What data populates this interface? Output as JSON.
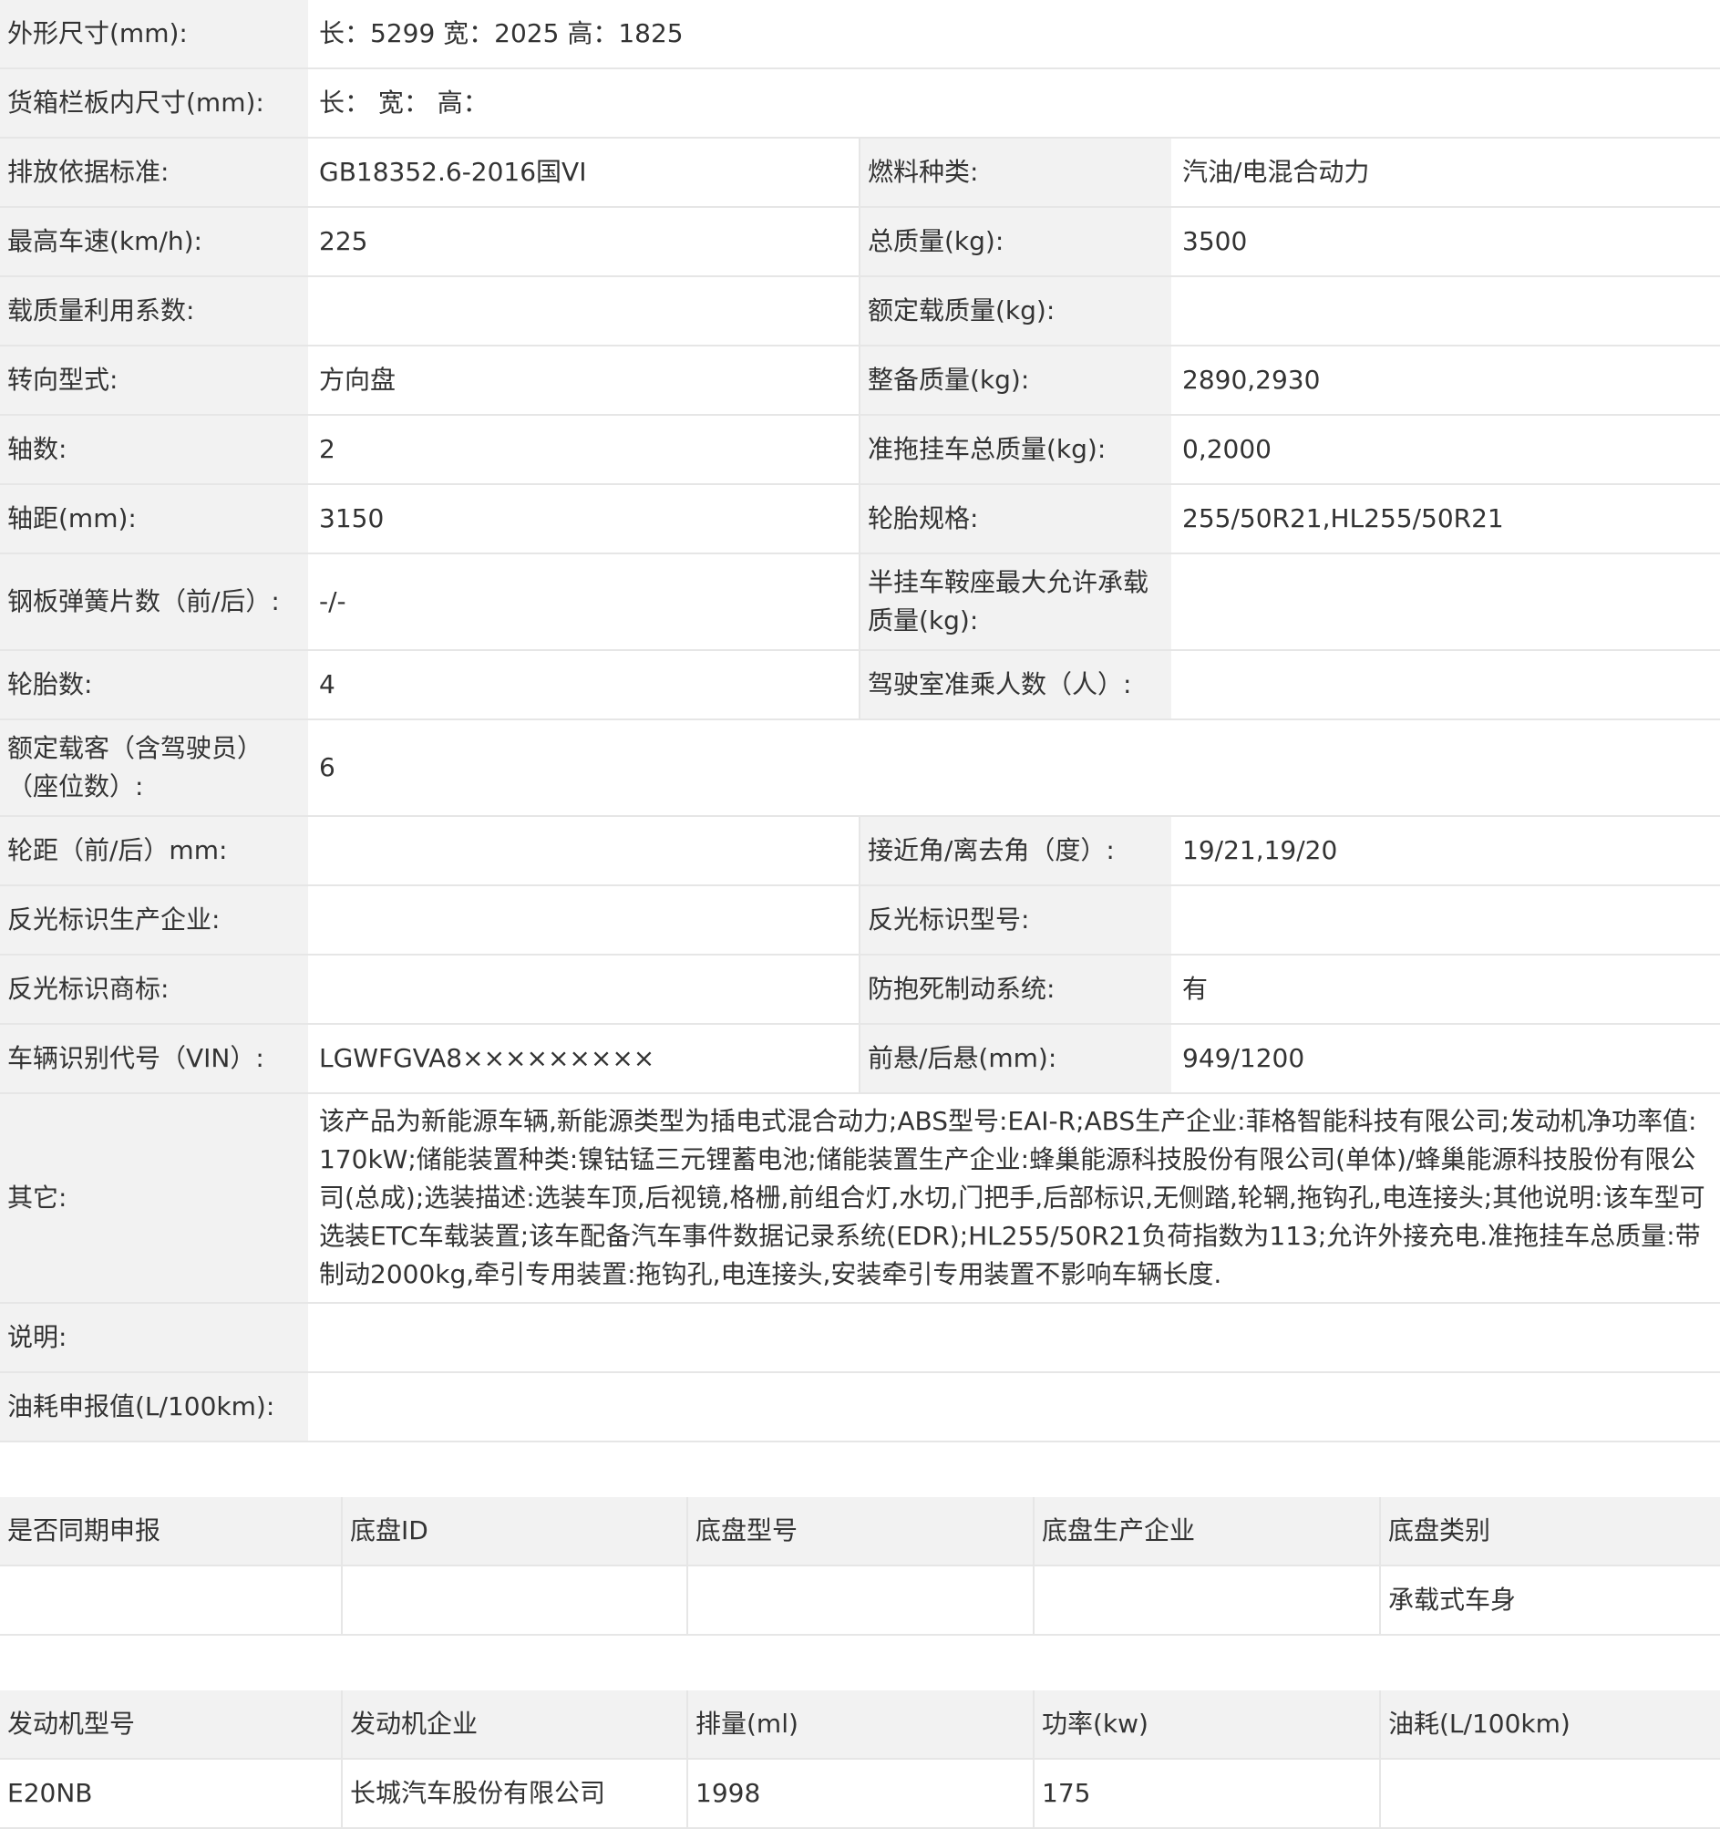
{
  "spec": {
    "dims_label": "外形尺寸(mm):",
    "dims_value": "长：5299 宽：2025 高：1825",
    "cargo_label": "货箱栏板内尺寸(mm):",
    "cargo_value": "长：  宽：  高：",
    "emission_label": "排放依据标准:",
    "emission_value": "GB18352.6-2016国VI",
    "fuel_label": "燃料种类:",
    "fuel_value": "汽油/电混合动力",
    "speed_label": "最高车速(km/h):",
    "speed_value": "225",
    "total_mass_label": "总质量(kg):",
    "total_mass_value": "3500",
    "load_coef_label": "载质量利用系数:",
    "load_coef_value": "",
    "rated_load_label": "额定载质量(kg):",
    "rated_load_value": "",
    "steering_label": "转向型式:",
    "steering_value": "方向盘",
    "curb_mass_label": "整备质量(kg):",
    "curb_mass_value": "2890,2930",
    "axles_label": "轴数:",
    "axles_value": "2",
    "trailer_mass_label": "准拖挂车总质量(kg):",
    "trailer_mass_value": "0,2000",
    "wheelbase_label": "轴距(mm):",
    "wheelbase_value": "3150",
    "tire_spec_label": "轮胎规格:",
    "tire_spec_value": "255/50R21,HL255/50R21",
    "leaf_spring_label": "钢板弹簧片数（前/后）:",
    "leaf_spring_value": "-/-",
    "saddle_label": "半挂车鞍座最大允许承载质量(kg):",
    "saddle_value": "",
    "tires_label": "轮胎数:",
    "tires_value": "4",
    "cab_seats_label": "驾驶室准乘人数（人）:",
    "cab_seats_value": "",
    "passengers_label": "额定载客（含驾驶员）（座位数）:",
    "passengers_value": "6",
    "track_label": "轮距（前/后）mm:",
    "track_value": "",
    "angle_label": "接近角/离去角（度）:",
    "angle_value": "19/21,19/20",
    "reflect_maker_label": "反光标识生产企业:",
    "reflect_maker_value": "",
    "reflect_model_label": "反光标识型号:",
    "reflect_model_value": "",
    "reflect_brand_label": "反光标识商标:",
    "reflect_brand_value": "",
    "abs_label": "防抱死制动系统:",
    "abs_value": "有",
    "vin_label": "车辆识别代号（VIN）:",
    "vin_value": "LGWFGVA8×××××××××",
    "overhang_label": "前悬/后悬(mm):",
    "overhang_value": "949/1200",
    "other_label": "其它:",
    "other_value": "该产品为新能源车辆,新能源类型为插电式混合动力;ABS型号:EAI-R;ABS生产企业:菲格智能科技有限公司;发动机净功率值:170kW;储能装置种类:镍钴锰三元锂蓄电池;储能装置生产企业:蜂巢能源科技股份有限公司(单体)/蜂巢能源科技股份有限公司(总成);选装描述:选装车顶,后视镜,格栅,前组合灯,水切,门把手,后部标识,无侧踏,轮辋,拖钩孔,电连接头;其他说明:该车型可选装ETC车载装置;该车配备汽车事件数据记录系统(EDR);HL255/50R21负荷指数为113;允许外接充电.准拖挂车总质量:带制动2000kg,牵引专用装置:拖钩孔,电连接头,安装牵引专用装置不影响车辆长度.",
    "note_label": "说明:",
    "note_value": "",
    "consumption_label": "油耗申报值(L/100km):",
    "consumption_value": ""
  },
  "chassis": {
    "headers": [
      "是否同期申报",
      "底盘ID",
      "底盘型号",
      "底盘生产企业",
      "底盘类别"
    ],
    "row": [
      "",
      "",
      "",
      "",
      "承载式车身"
    ]
  },
  "engine": {
    "headers": [
      "发动机型号",
      "发动机企业",
      "排量(ml)",
      "功率(kw)",
      "油耗(L/100km)"
    ],
    "row": [
      "E20NB",
      "长城汽车股份有限公司",
      "1998",
      "175",
      ""
    ]
  },
  "colors": {
    "label_bg": "#f2f2f2",
    "border": "#e6e6e6",
    "text": "#333333"
  }
}
